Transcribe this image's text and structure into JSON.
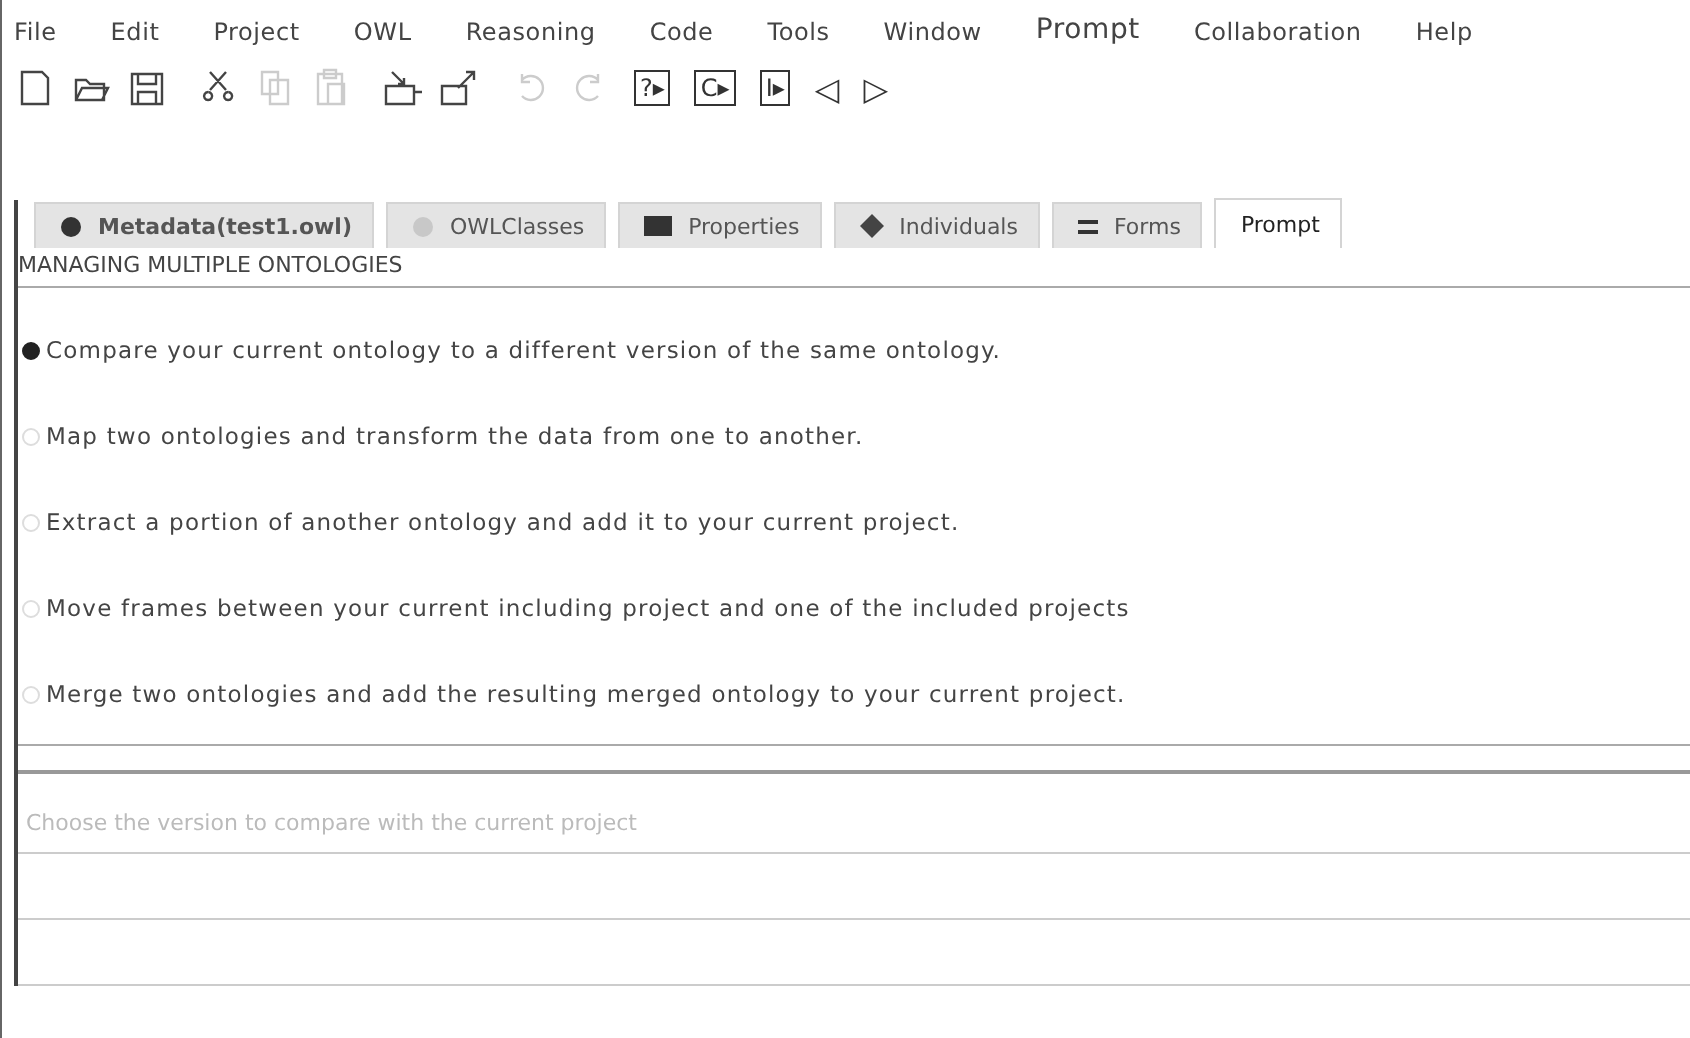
{
  "menu": [
    {
      "label": "File"
    },
    {
      "label": "Edit"
    },
    {
      "label": "Project"
    },
    {
      "label": "OWL"
    },
    {
      "label": "Reasoning"
    },
    {
      "label": "Code"
    },
    {
      "label": "Tools"
    },
    {
      "label": "Window"
    },
    {
      "label": "Prompt"
    },
    {
      "label": "Collaboration"
    },
    {
      "label": "Help"
    }
  ],
  "toolbar": [
    {
      "kind": "new",
      "disabled": false
    },
    {
      "kind": "open",
      "disabled": false
    },
    {
      "kind": "save",
      "disabled": false
    },
    {
      "kind": "cut",
      "disabled": false
    },
    {
      "kind": "copy",
      "disabled": true
    },
    {
      "kind": "paste",
      "disabled": true
    },
    {
      "kind": "import",
      "disabled": false
    },
    {
      "kind": "export",
      "disabled": false
    },
    {
      "kind": "undo",
      "disabled": true
    },
    {
      "kind": "redo",
      "disabled": true
    },
    {
      "kind": "boxed",
      "text": "?▸",
      "disabled": false
    },
    {
      "kind": "boxed",
      "text": "C▸",
      "disabled": false
    },
    {
      "kind": "boxed",
      "text": "I▸",
      "disabled": false
    },
    {
      "kind": "glyph",
      "text": "◁",
      "disabled": false
    },
    {
      "kind": "glyph",
      "text": "▷",
      "disabled": false
    }
  ],
  "tabs": [
    {
      "label": "Metadata(test1.owl)",
      "kind": "dot",
      "selected": false
    },
    {
      "label": "OWLClasses",
      "kind": "greydot",
      "selected": false
    },
    {
      "label": "Properties",
      "kind": "rect",
      "selected": false
    },
    {
      "label": "Individuals",
      "kind": "diamond",
      "selected": false
    },
    {
      "label": "Forms",
      "kind": "lines",
      "selected": false
    },
    {
      "label": "Prompt",
      "kind": "plain",
      "selected": true
    }
  ],
  "heading": "MANAGING MULTIPLE ONTOLOGIES",
  "options": [
    {
      "label": "Compare your current ontology to a different version of the same ontology.",
      "selected": true
    },
    {
      "label": "Map two ontologies and transform the data from one to another.",
      "selected": false
    },
    {
      "label": "Extract a portion of another ontology and add it to your current project.",
      "selected": false
    },
    {
      "label": "Move frames between your current including project and one of the included projects",
      "selected": false
    },
    {
      "label": "Merge two ontologies and add the resulting merged ontology to your current project.",
      "selected": false
    }
  ],
  "version_panel": {
    "label": "Choose the version to compare with the current project"
  }
}
